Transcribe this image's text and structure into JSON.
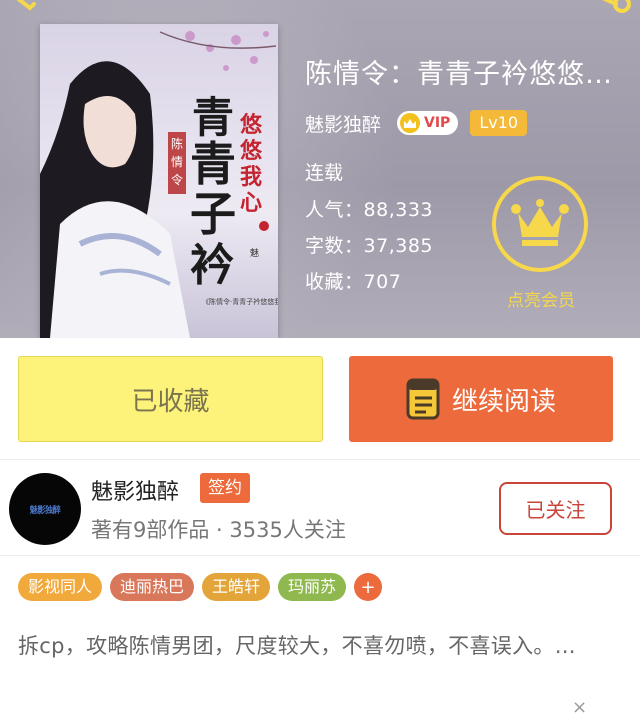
{
  "book": {
    "title": "陈情令：青青子衿悠悠我心",
    "author": "魅影独醉",
    "vip_label": "VIP",
    "level": "Lv10",
    "status": "连载",
    "stats": [
      {
        "label": "人气：",
        "value": "88,333"
      },
      {
        "label": "字数：",
        "value": "37,385"
      },
      {
        "label": "收藏：",
        "value": "707"
      }
    ],
    "member_label": "点亮会员",
    "cover": {
      "title_chars": "青青子衿",
      "subtitle_chars": "悠悠我心",
      "series_chars": "陈情令",
      "author_mark": "魅影独醉",
      "tagline": "《陈情令·青青子衿悠悠我心》"
    }
  },
  "actions": {
    "collect_label": "已收藏",
    "read_label": "继续阅读"
  },
  "author_card": {
    "name": "魅影独醉",
    "sign_badge": "签约",
    "meta": "著有9部作品 · 3535人关注",
    "follow_label": "已关注",
    "avatar_text": "魅影独醉"
  },
  "tags": [
    {
      "label": "影视同人",
      "color": "#f2a93b"
    },
    {
      "label": "迪丽热巴",
      "color": "#d9775b"
    },
    {
      "label": "王皓轩",
      "color": "#e3a53a"
    },
    {
      "label": "玛丽苏",
      "color": "#8fb84e"
    }
  ],
  "tag_add_label": "+",
  "description": "拆cp，攻略陈情男团，尺度较大，不喜勿喷，不喜误入。…",
  "close_icon": "×",
  "colors": {
    "accent_orange": "#ec6a3b",
    "collect_yellow": "#fdf27a",
    "member_gold": "#f7d84a",
    "follow_red": "#c9453a"
  }
}
